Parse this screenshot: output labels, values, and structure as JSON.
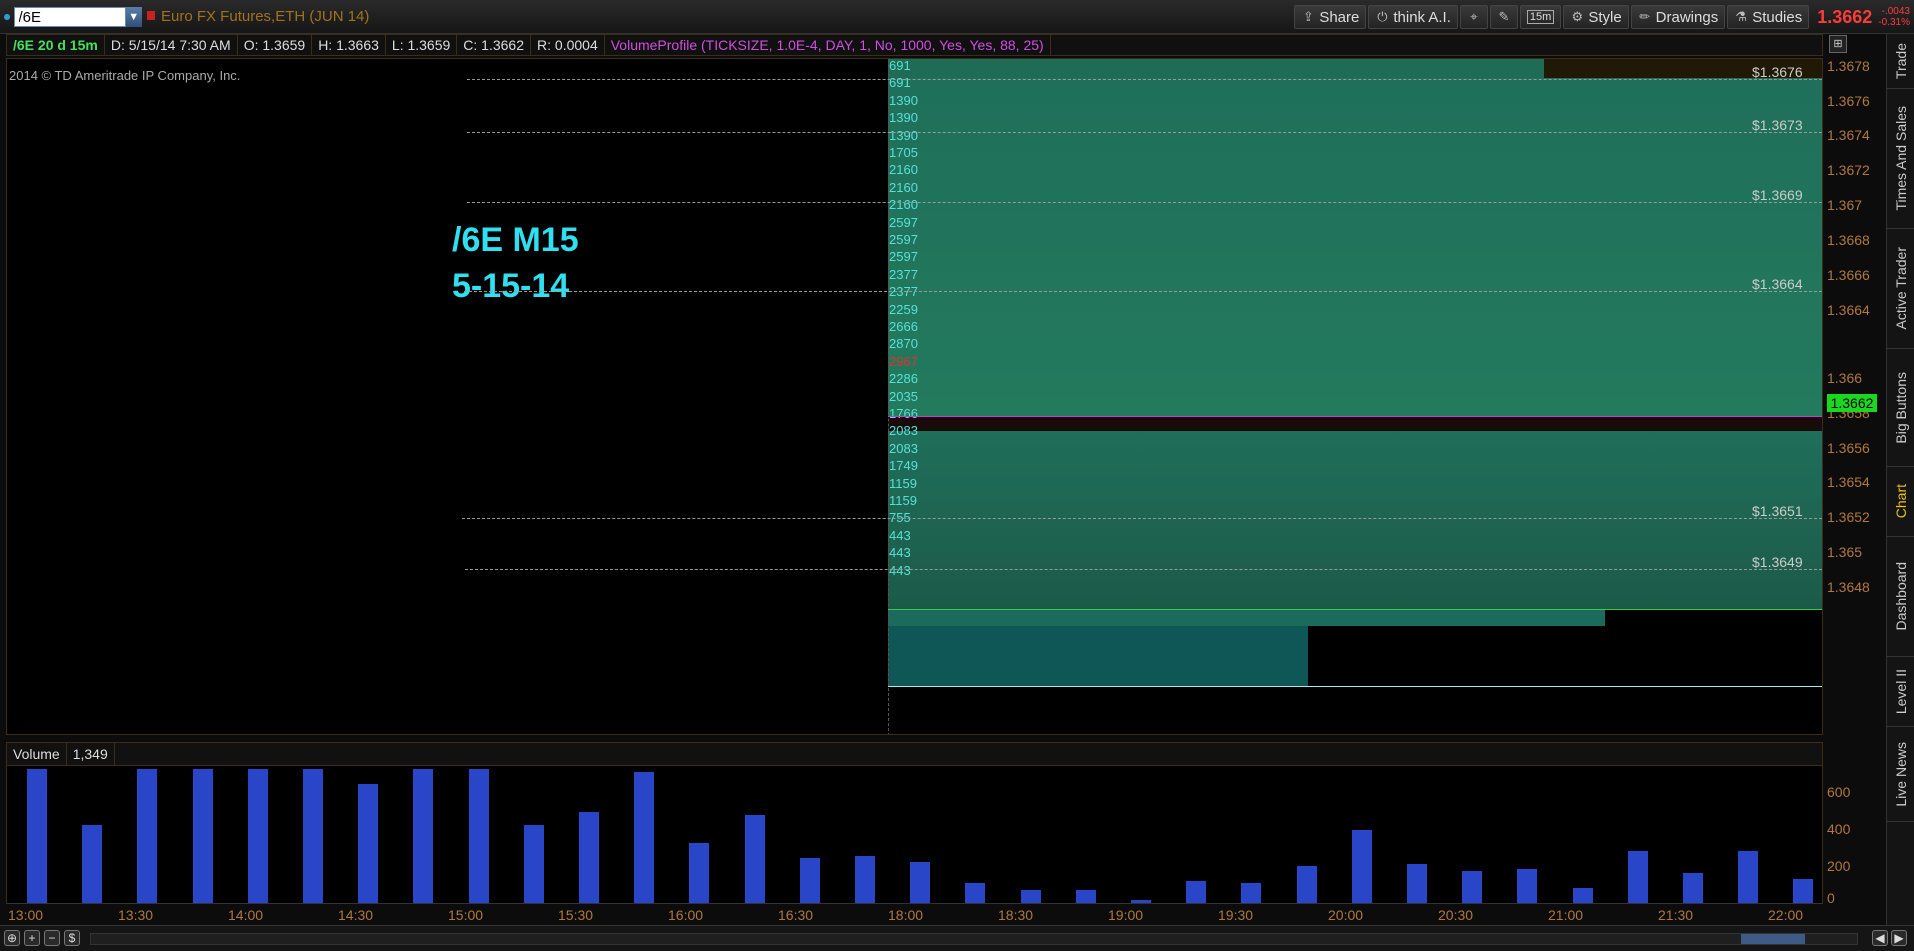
{
  "toolbar": {
    "symbol": "/6E",
    "instrument": "Euro FX Futures,ETH (JUN 14)",
    "share": "Share",
    "think_ai": "think A.I.",
    "timeframe": "15m",
    "style": "Style",
    "drawings": "Drawings",
    "studies": "Studies",
    "last_price": "1.3662",
    "change_abs": "-.0043",
    "change_pct": "-0.31%"
  },
  "header": {
    "symbol_period": "/6E 20 d 15m",
    "date": "D: 5/15/14 7:30 AM",
    "open": "O: 1.3659",
    "high": "H: 1.3663",
    "low": "L: 1.3659",
    "close": "C: 1.3662",
    "range": "R: 0.0004",
    "study": "VolumeProfile (TICKSIZE, 1.0E-4, DAY, 1, No, 1000, Yes, Yes, 88, 25)"
  },
  "chart": {
    "copyright": "2014 © TD Ameritrade IP Company, Inc.",
    "note_line1": "/6E M15",
    "note_line2": "5-15-14",
    "level_labels": [
      "$1.3676",
      "$1.3673",
      "$1.3669",
      "$1.3664",
      "$1.3651",
      "$1.3649"
    ],
    "profile_labels": [
      "691",
      "691",
      "1390",
      "1390",
      "1390",
      "1705",
      "2160",
      "2160",
      "2160",
      "2597",
      "2597",
      "2597",
      "2377",
      "2377",
      "2259",
      "2666",
      "2870",
      "2967",
      "2286",
      "2035",
      "1766",
      "2083",
      "2083",
      "1749",
      "1159",
      "1159",
      "755",
      "443",
      "443",
      "443"
    ],
    "price_ticks": [
      "1.3678",
      "1.3676",
      "1.3674",
      "1.3672",
      "1.367",
      "1.3668",
      "1.3666",
      "1.3664",
      "1.366",
      "1.3658",
      "1.3656",
      "1.3654",
      "1.3652",
      "1.365",
      "1.3648"
    ],
    "current_price": "1.3662"
  },
  "volume": {
    "label": "Volume",
    "value": "1,349",
    "ticks": [
      "600",
      "400",
      "200",
      "0"
    ]
  },
  "time_ticks": [
    "13:00",
    "13:30",
    "14:00",
    "14:30",
    "15:00",
    "15:30",
    "16:00",
    "16:30",
    "18:00",
    "18:30",
    "19:00",
    "19:30",
    "20:00",
    "20:30",
    "21:00",
    "21:30",
    "22:00"
  ],
  "chart_data": {
    "type": "bar",
    "title": "",
    "xlabel": "",
    "ylabel": "",
    "ylim": [
      0,
      720
    ],
    "values": [
      720,
      420,
      720,
      720,
      720,
      720,
      640,
      720,
      720,
      420,
      490,
      700,
      320,
      470,
      240,
      250,
      220,
      110,
      70,
      70,
      15,
      120,
      110,
      200,
      390,
      210,
      170,
      180,
      80,
      280,
      160,
      280,
      130
    ]
  },
  "sidebar": {
    "tabs": [
      "Trade",
      "Times And Sales",
      "Active Trader",
      "Big Buttons",
      "Chart",
      "Dashboard",
      "Level II",
      "Live News"
    ]
  }
}
